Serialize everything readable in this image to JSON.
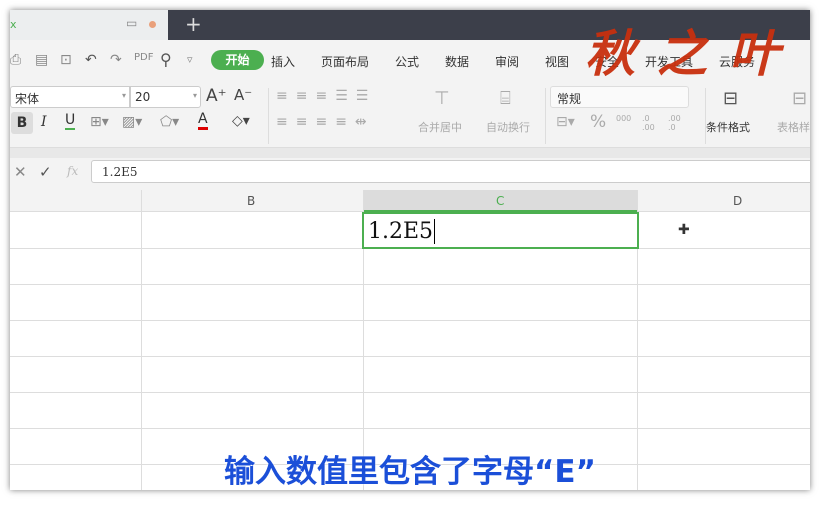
{
  "tabs": {
    "new_tab": "+"
  },
  "menu": [
    "开始",
    "插入",
    "页面布局",
    "公式",
    "数据",
    "审阅",
    "视图",
    "安全",
    "开发工具",
    "云服务"
  ],
  "font": {
    "name": "宋体",
    "size": "20"
  },
  "ribbon": {
    "merge": "合并居中",
    "wrap": "自动换行",
    "number_format": "常规",
    "cond_format": "条件格式",
    "table_style": "表格样"
  },
  "formula": {
    "fx": "fx",
    "value": "1.2E5"
  },
  "columns": [
    "B",
    "C",
    "D"
  ],
  "cell_c1": "1.2E5",
  "caption": "输入数值里包含了字母“E”",
  "logo": "秋之叶",
  "colors": {
    "accent": "#4caf50",
    "caption": "#1b4fd8",
    "logo": "#c8300e"
  }
}
